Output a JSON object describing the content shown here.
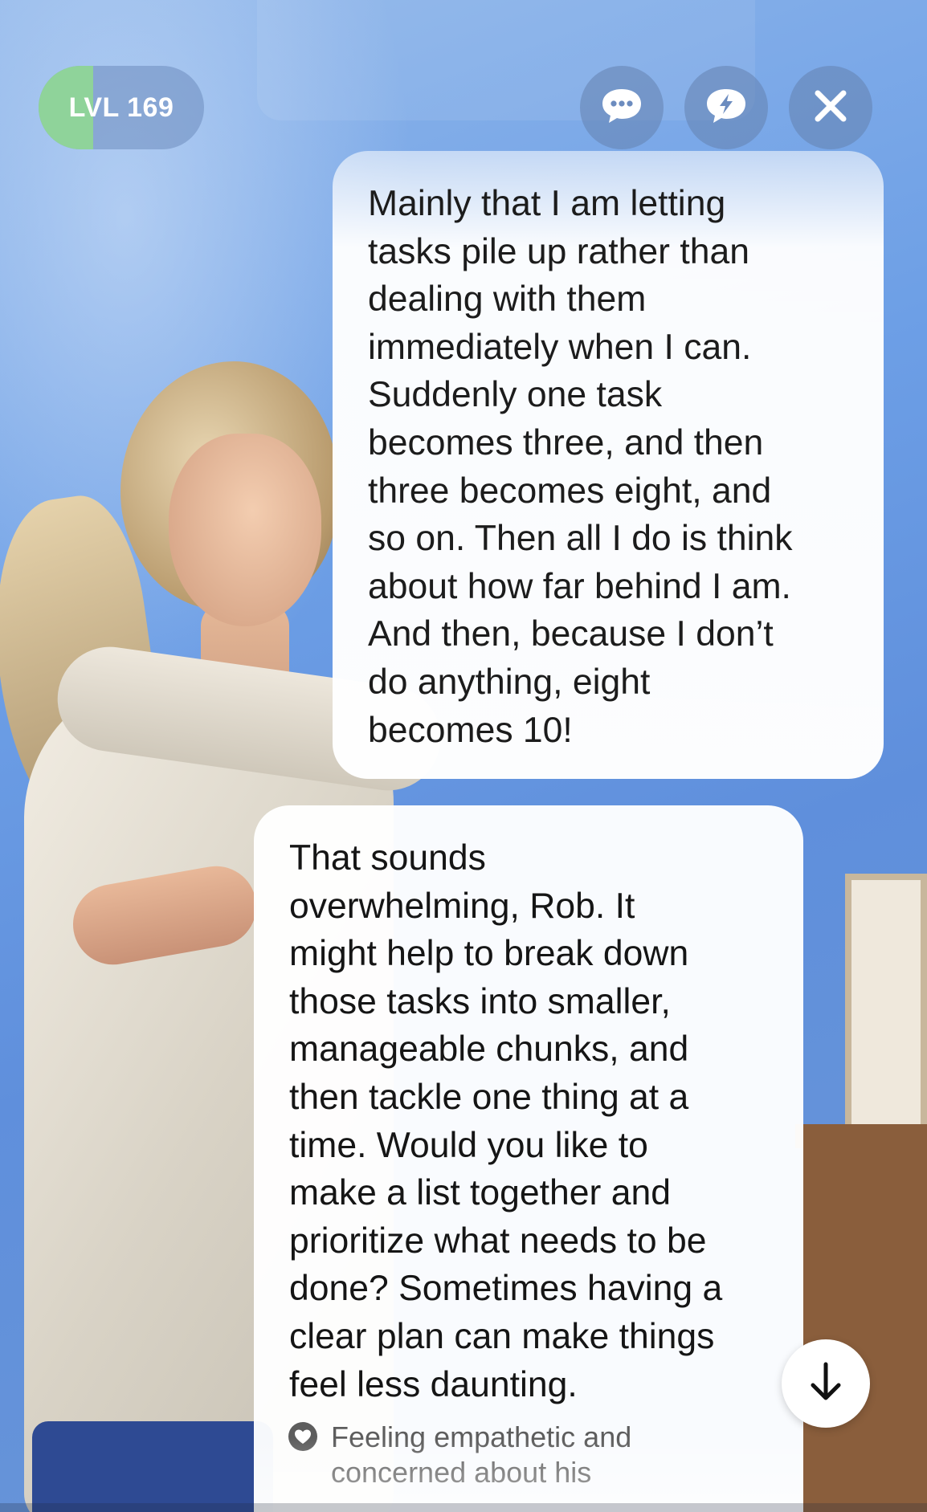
{
  "level": {
    "label": "LVL 169",
    "progress": 0.33,
    "fill_color": "#8fd39a"
  },
  "header_buttons": {
    "chat_icon": "chat-bubble-dots-icon",
    "bolt_icon": "lightning-bubble-icon",
    "close_icon": "close-icon"
  },
  "messages": [
    {
      "role": "user",
      "text": "Mainly that I am letting\ntasks pile up rather than\ndealing with them\nimmediately when I can.\nSuddenly one task\nbecomes three, and then\nthree becomes eight, and\nso on. Then all I do is think\nabout how far behind I am.\nAnd then, because I don’t\ndo anything, eight\nbecomes 10!"
    },
    {
      "role": "assistant",
      "text": "That sounds\noverwhelming, Rob. It\nmight help to break down\nthose tasks into smaller,\nmanageable chunks, and\nthen tackle one thing at a\ntime. Would you like to\nmake a list together and\nprioritize what needs to be\ndone? Sometimes having a\nclear plan can make things\nfeel less daunting.",
      "mood": "Feeling empathetic and\nconcerned about his",
      "mood_icon": "heart-icon"
    }
  ],
  "scroll_button": {
    "icon": "arrow-down-icon"
  },
  "colors": {
    "background": "#6d9fe6",
    "bubble": "#ffffff",
    "text": "#151515",
    "mood_text": "#5d5d5d"
  }
}
